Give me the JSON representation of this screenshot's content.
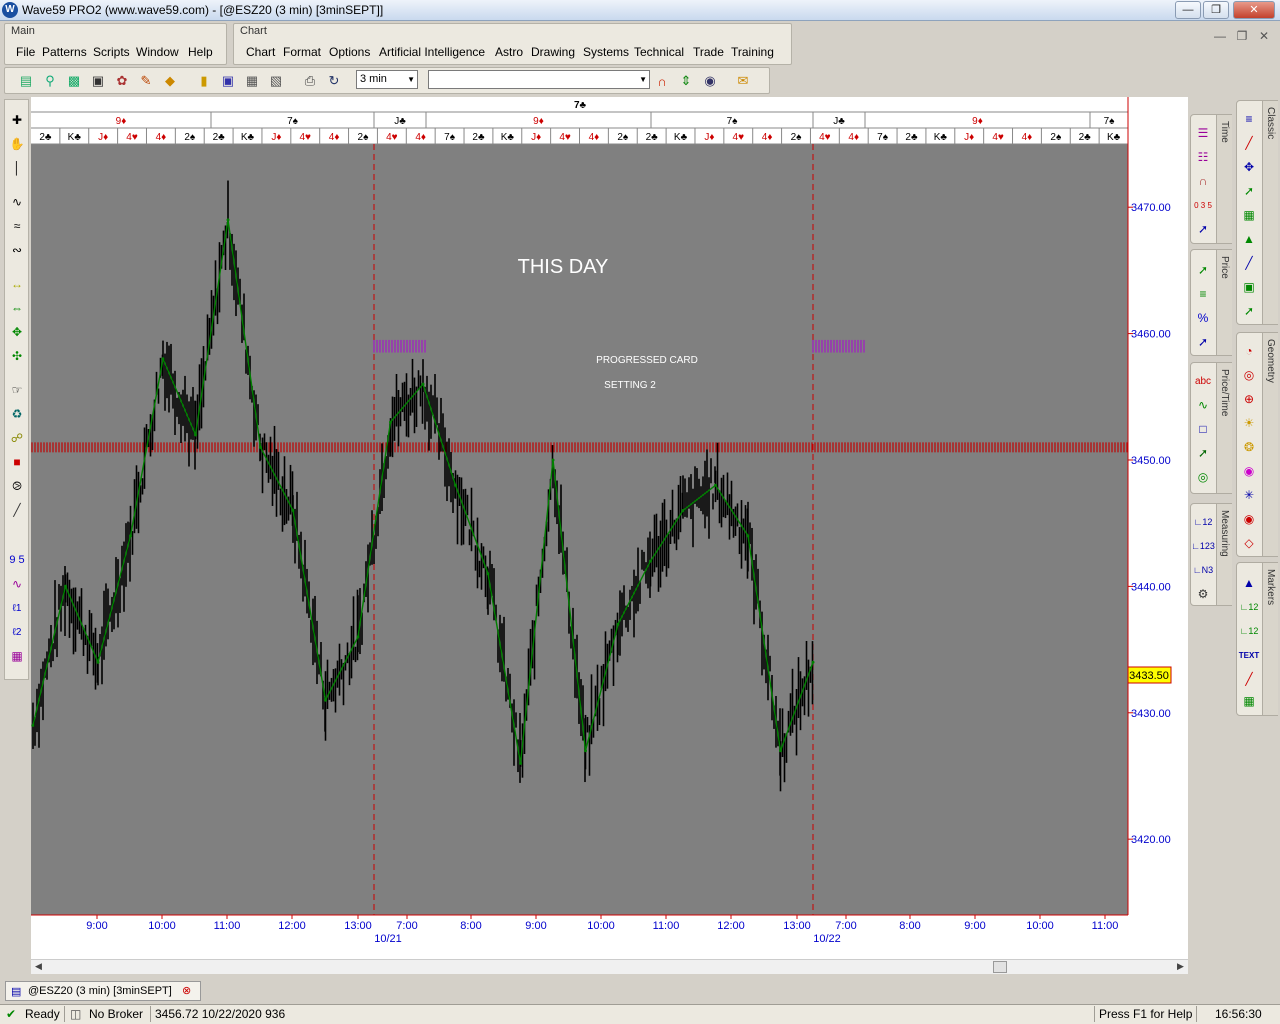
{
  "window": {
    "title": "Wave59 PRO2 (www.wave59.com) - [@ESZ20 (3 min) [3minSEPT]]",
    "app_icon": "W"
  },
  "menubar": {
    "main_band_label": "Main",
    "chart_band_label": "Chart",
    "main_items": [
      "File",
      "Patterns",
      "Scripts",
      "Window",
      "Help"
    ],
    "chart_items": [
      "Chart",
      "Format",
      "Options",
      "Artificial Intelligence",
      "Astro",
      "Drawing",
      "Systems",
      "Technical",
      "Trade",
      "Training"
    ]
  },
  "toolbar": {
    "timeframe": "3 min",
    "symbol": "",
    "icons": [
      "new-chart-icon",
      "zoom-icon",
      "refresh-icon",
      "camera-icon",
      "bug-icon",
      "paint-icon",
      "signal-icon",
      "folder-icon",
      "save-icon",
      "chart-save-icon",
      "chart-open-icon",
      "print-icon",
      "redo-icon",
      "magnet-icon",
      "updown-icon",
      "eye-icon",
      "mail-icon"
    ]
  },
  "left_toolbar": {
    "icons": [
      "crosshair-icon",
      "hand-icon",
      "cursor-line-icon",
      "zigzag-icon",
      "wave-icon",
      "curve-icon",
      "time-zoom-icon",
      "time-compress-icon",
      "price-zoom-icon",
      "move-icon",
      "grab-icon",
      "trash-icon",
      "link-icon",
      "car-icon",
      "lasso-icon",
      "ruler-icon",
      "count-icon",
      "sine-icon",
      "fib-1-icon",
      "fib-2-icon",
      "square-icon"
    ],
    "count_label": "9 5"
  },
  "right_panels": {
    "time": "Time",
    "price": "Price",
    "price_time": "Price/Time",
    "measuring": "Measuring",
    "classic": "Classic",
    "geometry": "Geometry",
    "markers": "Markers",
    "text_tool": "TEXT",
    "abc_tool": "abc"
  },
  "chart": {
    "annotation_main": "THIS DAY",
    "annotation_sub1": "PROGRESSED CARD",
    "annotation_sub2": "SETTING 2",
    "current_price": "3433.50",
    "price_ticks": [
      "3470.00",
      "3460.00",
      "3450.00",
      "3440.00",
      "3430.00",
      "3420.00"
    ],
    "time_ticks": [
      "9:00",
      "10:00",
      "11:00",
      "12:00",
      "13:00",
      "7:00",
      "8:00",
      "9:00",
      "10:00",
      "11:00",
      "12:00",
      "13:00",
      "7:00",
      "8:00",
      "9:00",
      "10:00",
      "11:00"
    ],
    "date_labels": [
      "10/21",
      "10/22"
    ],
    "card_row1": [
      "7♣"
    ],
    "card_row2": [
      "9♦",
      "7♠",
      "J♣",
      "9♦",
      "7♠",
      "J♣",
      "9♦",
      "7♠"
    ],
    "card_row3": [
      "2♣",
      "K♣",
      "J♦",
      "4♥",
      "4♦",
      "2♠",
      "2♣",
      "K♣",
      "J♦",
      "4♥",
      "4♦",
      "2♠",
      "4♥",
      "4♦",
      "7♠",
      "2♣",
      "K♣",
      "J♦",
      "4♥",
      "4♦",
      "2♠",
      "2♣",
      "K♣",
      "J♦",
      "4♥",
      "4♦",
      "2♠",
      "4♥",
      "4♦",
      "7♠",
      "2♣",
      "K♣",
      "J♦",
      "4♥",
      "4♦",
      "2♠",
      "2♣",
      "K♣"
    ]
  },
  "chart_data": {
    "type": "line",
    "title": "",
    "xlabel": "",
    "ylabel": "",
    "ylim": [
      3414,
      3475
    ],
    "x": [
      "8:30",
      "9:00",
      "9:30",
      "10:00",
      "10:30",
      "11:00",
      "11:30",
      "12:00",
      "12:30",
      "13:00",
      "13:15",
      "7:00",
      "7:30",
      "8:00",
      "8:30",
      "9:00",
      "9:30",
      "10:00",
      "10:30",
      "11:00",
      "11:30",
      "12:00",
      "12:30",
      "13:00",
      "13:15"
    ],
    "series": [
      {
        "values": [
          3429,
          3440,
          3434,
          3444,
          3458,
          3452,
          3469,
          3451,
          3446,
          3431,
          3436,
          3453,
          3456,
          3448,
          3441,
          3426,
          3450,
          3427,
          3437,
          3442,
          3446,
          3448,
          3444,
          3427,
          3434
        ]
      }
    ],
    "horizontal_level": 3451,
    "session_separators": [
      "10/21 7:00",
      "10/22 7:00"
    ],
    "last_price": 3433.5,
    "background": "#808080",
    "price_color": "#000000",
    "swing_color": "#008000",
    "level_color": "#c00000"
  },
  "status": {
    "tab_label": "@ESZ20 (3 min) [3minSEPT]",
    "ready": "Ready",
    "broker": "No Broker",
    "info": "3456.72  10/22/2020  936",
    "help": "Press F1 for Help",
    "clock": "16:56:30"
  }
}
